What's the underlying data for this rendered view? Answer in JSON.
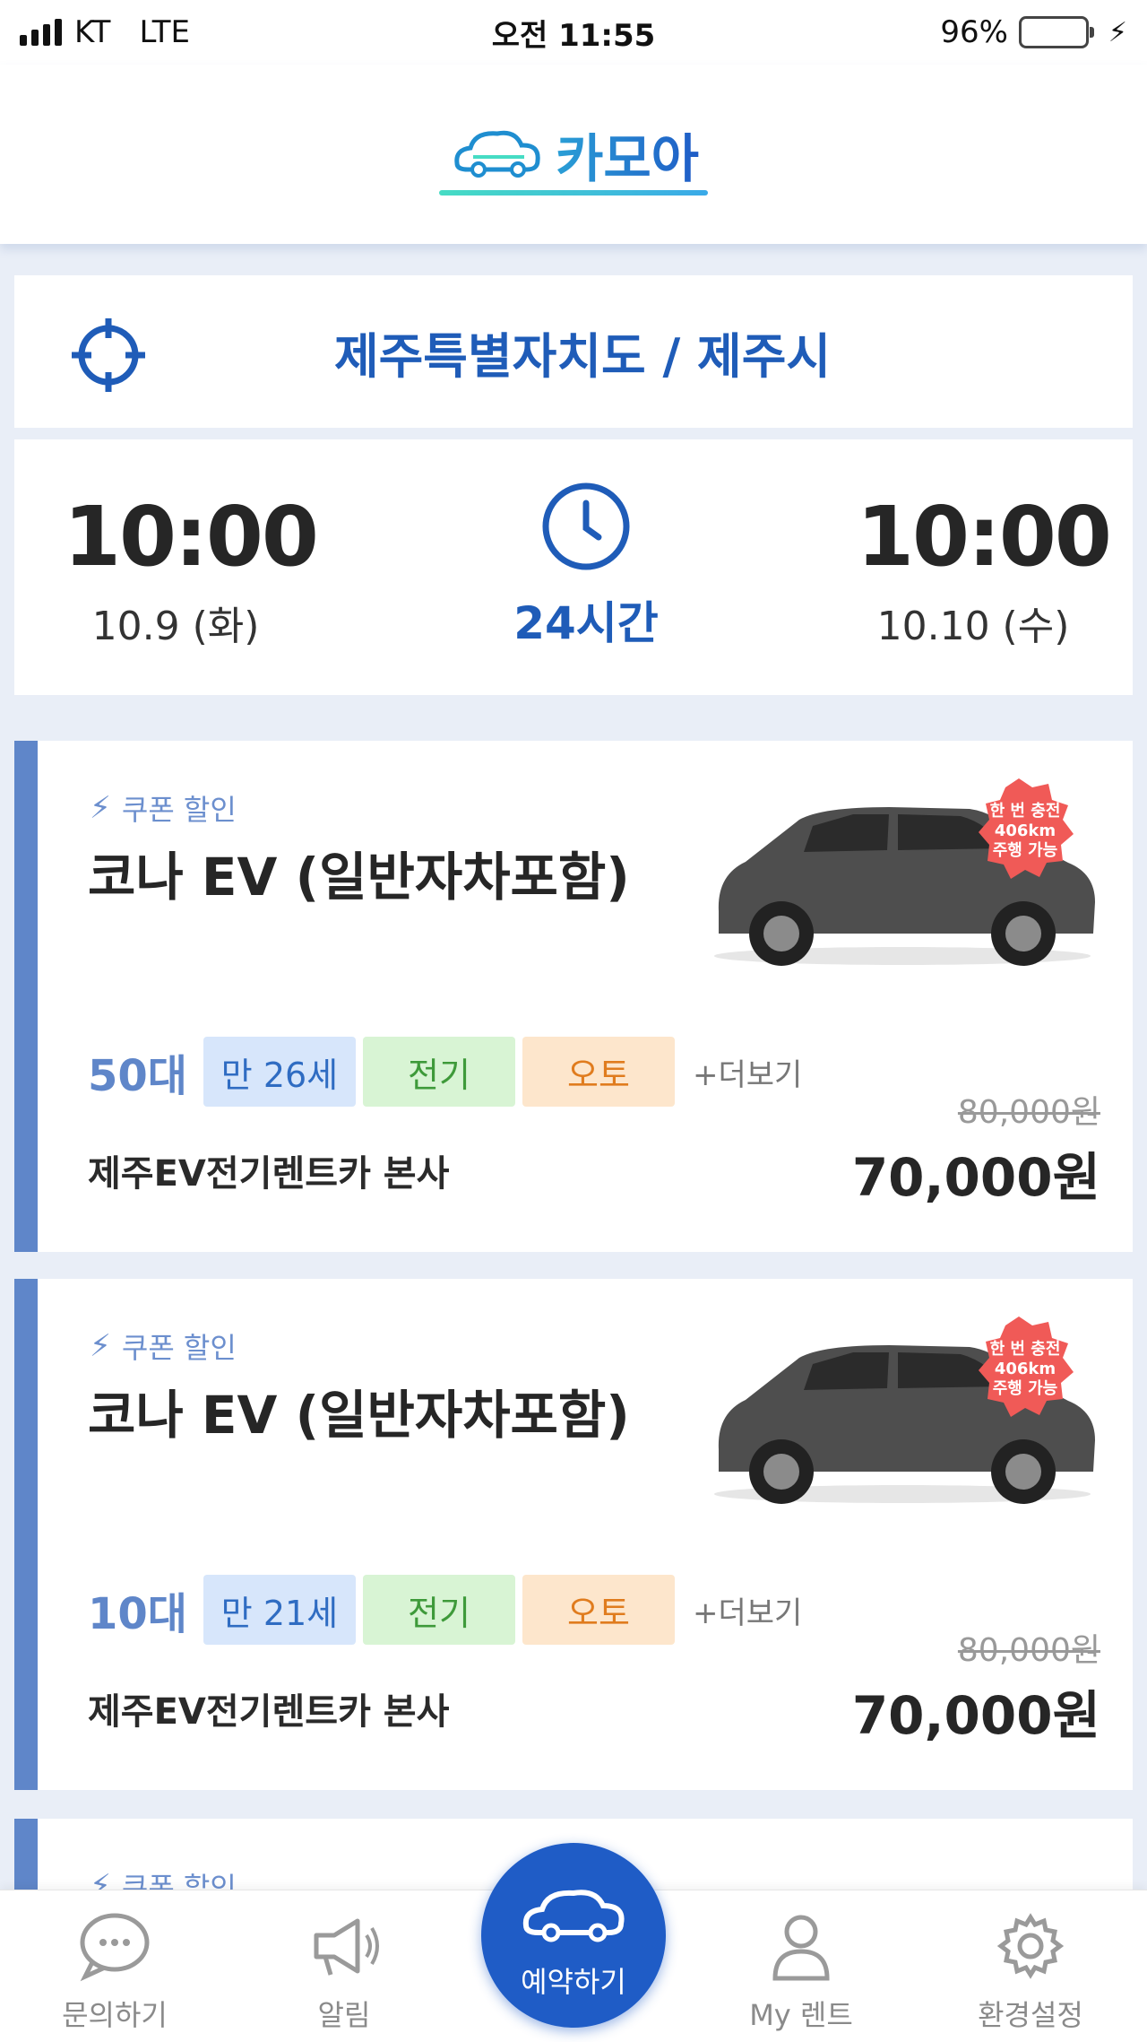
{
  "status_bar": {
    "carrier": "KT",
    "network": "LTE",
    "time": "오전 11:55",
    "battery": "96%",
    "battery_level": 0.96
  },
  "header": {
    "logo_text": "카모아"
  },
  "location": {
    "text": "제주특별자치도 / 제주시"
  },
  "rental_time": {
    "start_time": "10:00",
    "start_date": "10.9 (화)",
    "duration": "24시간",
    "end_time": "10:00",
    "end_date": "10.10 (수)"
  },
  "cars": [
    {
      "coupon": "쿠폰 할인",
      "name": "코나 EV (일반자차포함)",
      "count": "50대",
      "age": "만 26세",
      "fuel": "전기",
      "transmission": "오토",
      "more": "+더보기",
      "original_price": "80,000원",
      "price": "70,000원",
      "branch": "제주EV전기렌트카 본사",
      "badge": [
        "한 번 충전",
        "406km",
        "주행 가능"
      ]
    },
    {
      "coupon": "쿠폰 할인",
      "name": "코나 EV (일반자차포함)",
      "count": "10대",
      "age": "만 21세",
      "fuel": "전기",
      "transmission": "오토",
      "more": "+더보기",
      "original_price": "80,000원",
      "price": "70,000원",
      "branch": "제주EV전기렌트카 본사",
      "badge": [
        "한 번 충전",
        "406km",
        "주행 가능"
      ]
    },
    {
      "coupon": "쿠폰 할인"
    }
  ],
  "bottom_nav": {
    "inquiry": "문의하기",
    "alerts": "알림",
    "reserve": "예약하기",
    "my_rent": "My 렌트",
    "settings": "환경설정"
  },
  "colors": {
    "primary": "#1f5cc6",
    "accent_bar": "#5f86c9",
    "logo_teal": "#46dcc4"
  }
}
